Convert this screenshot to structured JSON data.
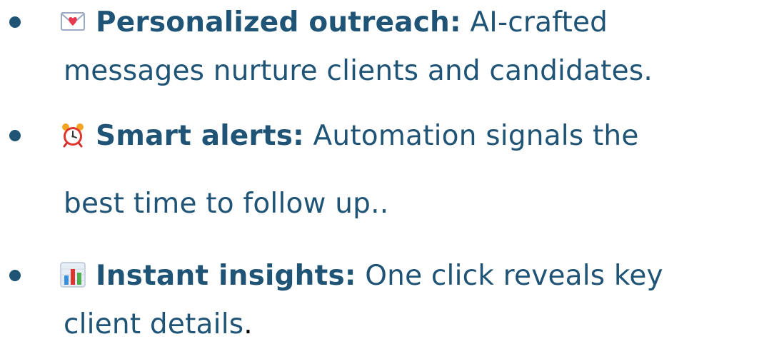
{
  "colors": {
    "text": "#1f5476",
    "final_period": "#000000"
  },
  "bullets": [
    {
      "icon": "love-letter-icon",
      "lead": "Personalized outreach:",
      "line1_rest": " AI-crafted",
      "line2": "messages nurture clients and candidates."
    },
    {
      "icon": "alarm-clock-icon",
      "lead": "Smart alerts:",
      "line1_rest": " Automation signals the",
      "line2": "best time to follow up.."
    },
    {
      "icon": "bar-chart-icon",
      "lead": "Instant insights:",
      "line1_rest": " One click reveals key",
      "line2": "client details",
      "line2_end": "."
    }
  ]
}
